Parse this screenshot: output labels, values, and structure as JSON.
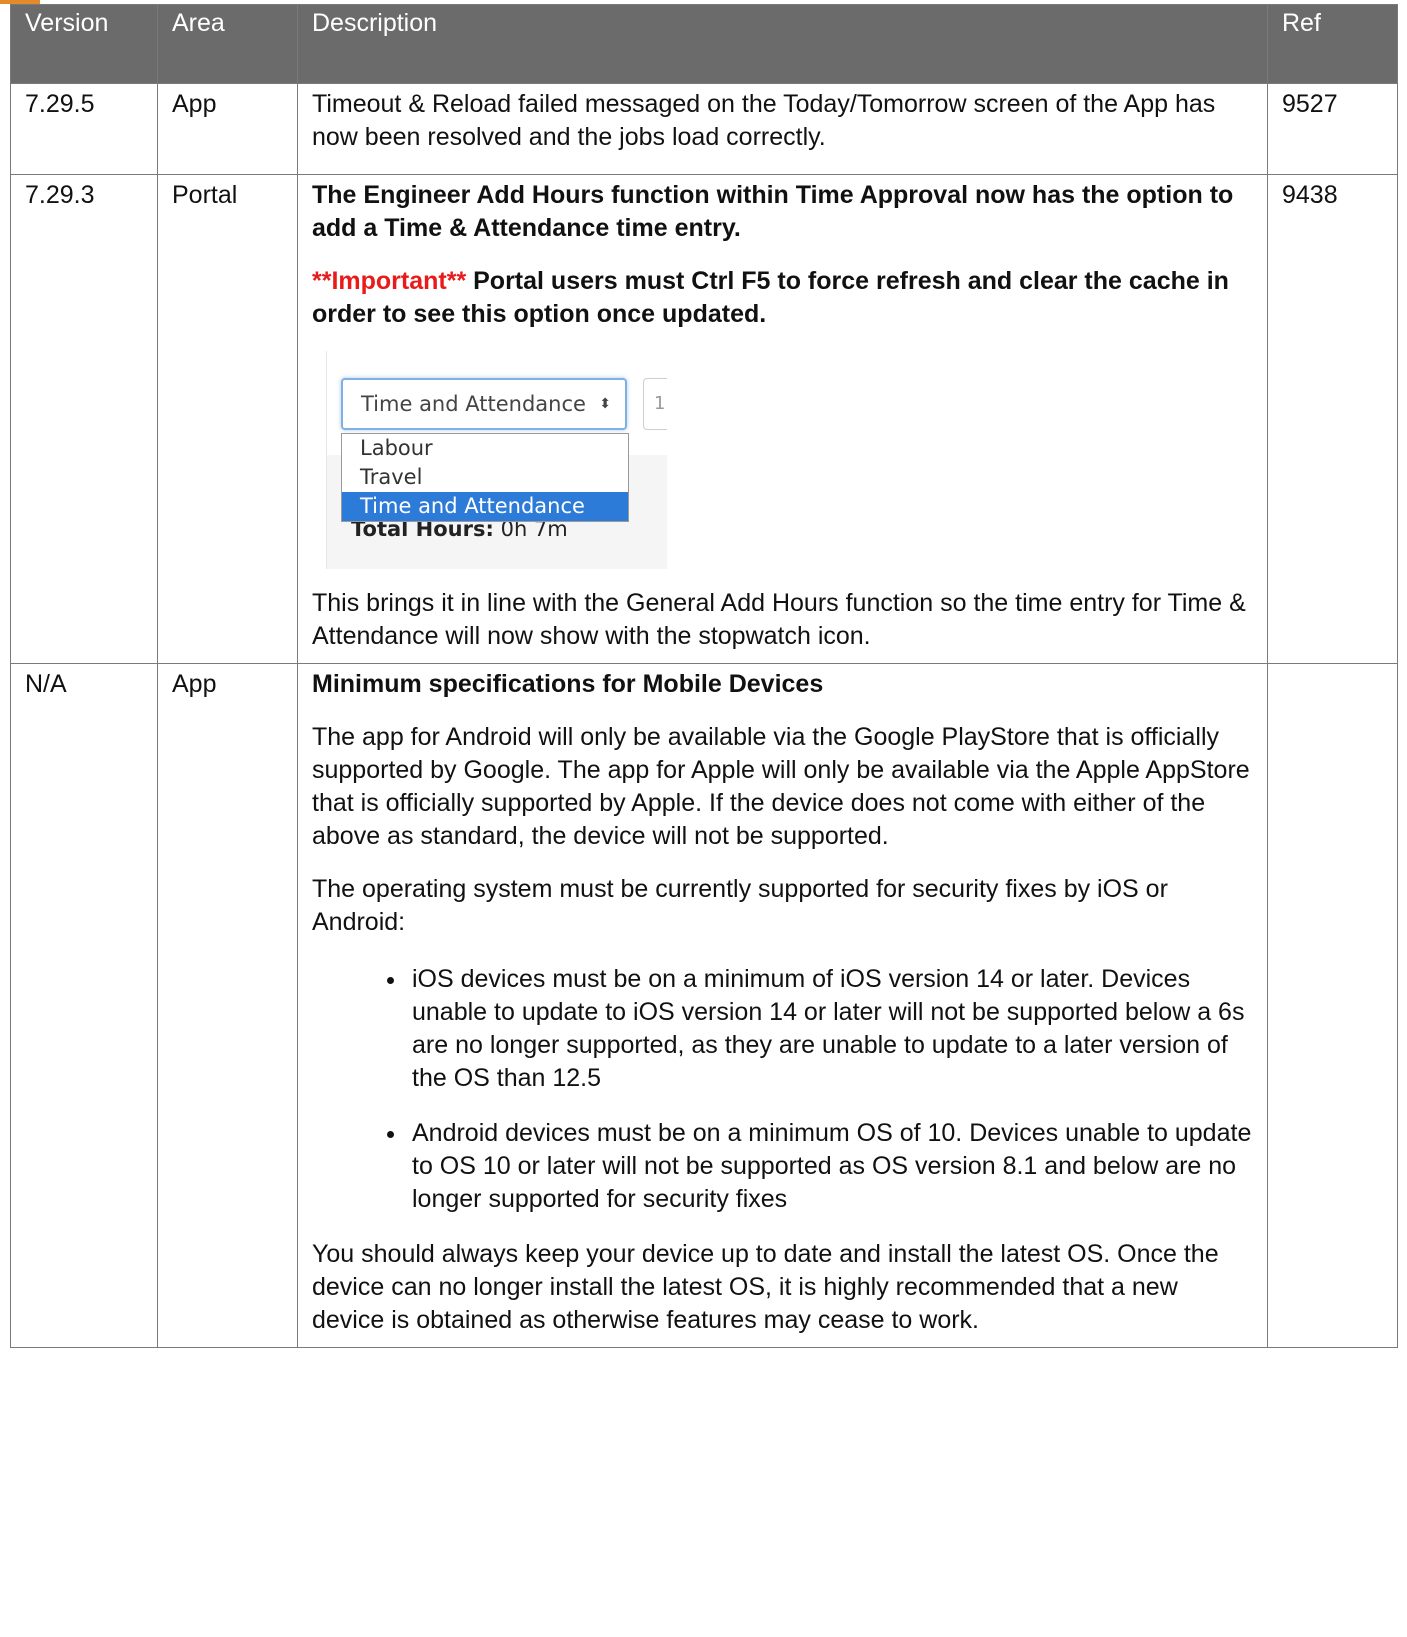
{
  "table": {
    "headers": {
      "version": "Version",
      "area": "Area",
      "description": "Description",
      "ref": "Ref"
    },
    "rows": [
      {
        "version": "7.29.5",
        "area": "App",
        "description": "Timeout & Reload failed messaged on the Today/Tomorrow screen of the App has now been resolved and the jobs load correctly.",
        "ref": "9527"
      },
      {
        "version": "7.29.3",
        "area": "Portal",
        "heading": "The Engineer Add Hours function within Time Approval now has the option to add a Time & Attendance time entry.",
        "important_label": "**Important**",
        "important_text": " Portal users must Ctrl F5 to force refresh and clear the cache in order to see this option once updated.",
        "screenshot": {
          "select_value": "Time and Attendance",
          "next_field_value": "1",
          "options": [
            "Labour",
            "Travel",
            "Time and Attendance"
          ],
          "selected_index": 2,
          "total_label": "Total Hours:",
          "total_value": "0h 7m"
        },
        "footer": "This brings it in line with the General Add Hours function so the time entry for Time & Attendance will now show with the stopwatch icon.",
        "ref": "9438"
      },
      {
        "version": "N/A",
        "area": "App",
        "heading": "Minimum specifications for Mobile Devices",
        "para1": "The app for Android will only be available via the Google PlayStore that is officially supported by Google. The app for Apple will only be available via the Apple AppStore that is officially supported by Apple. If the device does not come with either of the above as standard, the device will not be supported.",
        "para2": "The operating system must be currently supported for security fixes by iOS or Android:",
        "bullets": [
          "iOS devices must be on a minimum of iOS version 14 or later. Devices unable to update to iOS version 14 or later will not be supported below a 6s are no longer supported, as they are unable to update to a later version of the OS than 12.5",
          "Android devices must be on a minimum OS of 10. Devices unable to update to OS 10 or later will not be supported as OS version 8.1 and below are no longer supported for security fixes"
        ],
        "para3": "You should always keep your device up to date and install the latest OS. Once the device can no longer install the latest OS, it is highly recommended that a new device is obtained as otherwise features may cease to work.",
        "ref": ""
      }
    ]
  },
  "colors": {
    "header_bg": "#6b6b6b",
    "important": "#e81a1a",
    "select_highlight": "#2d7bd8",
    "accent_strip": "#e58a2a"
  }
}
